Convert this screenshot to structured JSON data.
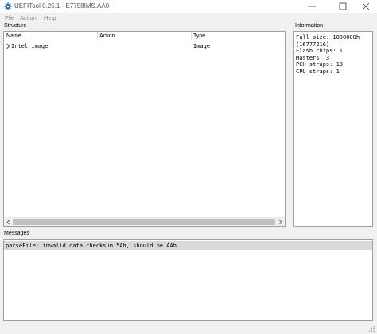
{
  "window": {
    "title": "UEFITool 0.25.1 - E7758IMS.AA0",
    "app_icon": "gear-icon",
    "controls": [
      "minimize-icon",
      "maximize-icon",
      "close-icon"
    ]
  },
  "menu": {
    "file": "File",
    "action": "Action",
    "help": "Help"
  },
  "structure": {
    "label": "Structure",
    "columns": {
      "name": "Name",
      "action": "Action",
      "type": "Type"
    },
    "rows": [
      {
        "name": "Intel image",
        "action": "",
        "type": "Image",
        "expander": "chevron-right-icon"
      }
    ]
  },
  "information": {
    "label": "Information",
    "lines": [
      "Full size: 1000000h",
      "(16777216)",
      "Flash chips: 1",
      "Masters: 3",
      "PCH straps: 18",
      "CPU straps: 1"
    ]
  },
  "messages": {
    "label": "Messages",
    "items": [
      "parseFile: invalid data checksum 5Ah, should be AAh"
    ]
  },
  "colors": {
    "panel_bg": "#ffffff",
    "window_bg": "#f0f0f0",
    "selected_message_bg": "#d9d9d9",
    "border": "#a0a0a0"
  }
}
